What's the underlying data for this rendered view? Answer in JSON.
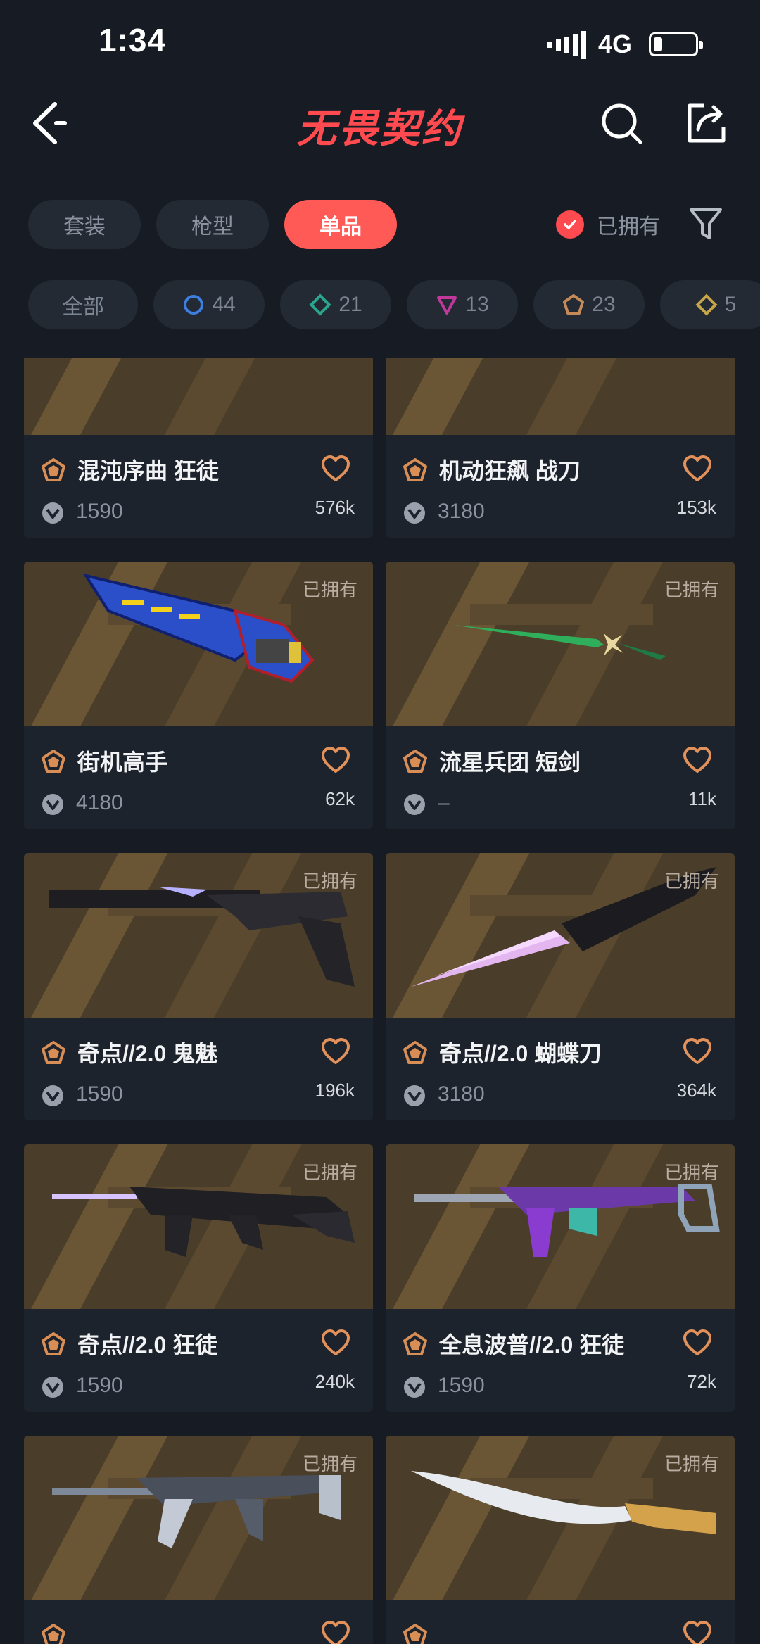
{
  "status": {
    "time": "1:34",
    "network": "4G"
  },
  "header": {
    "title": "无畏契约"
  },
  "tabs": [
    {
      "label": "套装",
      "active": false
    },
    {
      "label": "枪型",
      "active": false
    },
    {
      "label": "单品",
      "active": true
    }
  ],
  "owned_filter": {
    "label": "已拥有",
    "checked": true
  },
  "tiers": [
    {
      "label": "全部",
      "icon": ""
    },
    {
      "label": "44",
      "icon": "circle-tier-icon",
      "color": "#3d7fe0"
    },
    {
      "label": "21",
      "icon": "diamond-tier-icon",
      "color": "#2aa68f"
    },
    {
      "label": "13",
      "icon": "triangle-tier-icon",
      "color": "#c0389a"
    },
    {
      "label": "23",
      "icon": "pentagon-tier-icon",
      "color": "#c58a58"
    },
    {
      "label": "5",
      "icon": "diamond-gold-tier-icon",
      "color": "#c6a648"
    }
  ],
  "owned_tag": "已拥有",
  "items": [
    {
      "name": "混沌序曲 狂徒",
      "price": "1590",
      "likes": "576k",
      "owned": false,
      "weapon": "rifle-dark"
    },
    {
      "name": "机动狂飙 战刀",
      "price": "3180",
      "likes": "153k",
      "owned": false,
      "weapon": "knife-red"
    },
    {
      "name": "街机高手",
      "price": "4180",
      "likes": "62k",
      "owned": true,
      "weapon": "arcade-knife"
    },
    {
      "name": "流星兵团 短剑",
      "price": "–",
      "likes": "11k",
      "owned": true,
      "weapon": "green-dagger"
    },
    {
      "name": "奇点//2.0 鬼魅",
      "price": "1590",
      "likes": "196k",
      "owned": true,
      "weapon": "pistol-black"
    },
    {
      "name": "奇点//2.0 蝴蝶刀",
      "price": "3180",
      "likes": "364k",
      "owned": true,
      "weapon": "crystal-knife"
    },
    {
      "name": "奇点//2.0 狂徒",
      "price": "1590",
      "likes": "240k",
      "owned": true,
      "weapon": "rifle-black"
    },
    {
      "name": "全息波普//2.0 狂徒",
      "price": "1590",
      "likes": "72k",
      "owned": true,
      "weapon": "smg-holo"
    },
    {
      "name": "",
      "price": "",
      "likes": "",
      "owned": true,
      "weapon": "rifle-silver"
    },
    {
      "name": "",
      "price": "",
      "likes": "",
      "owned": true,
      "weapon": "kukri-gold"
    }
  ]
}
